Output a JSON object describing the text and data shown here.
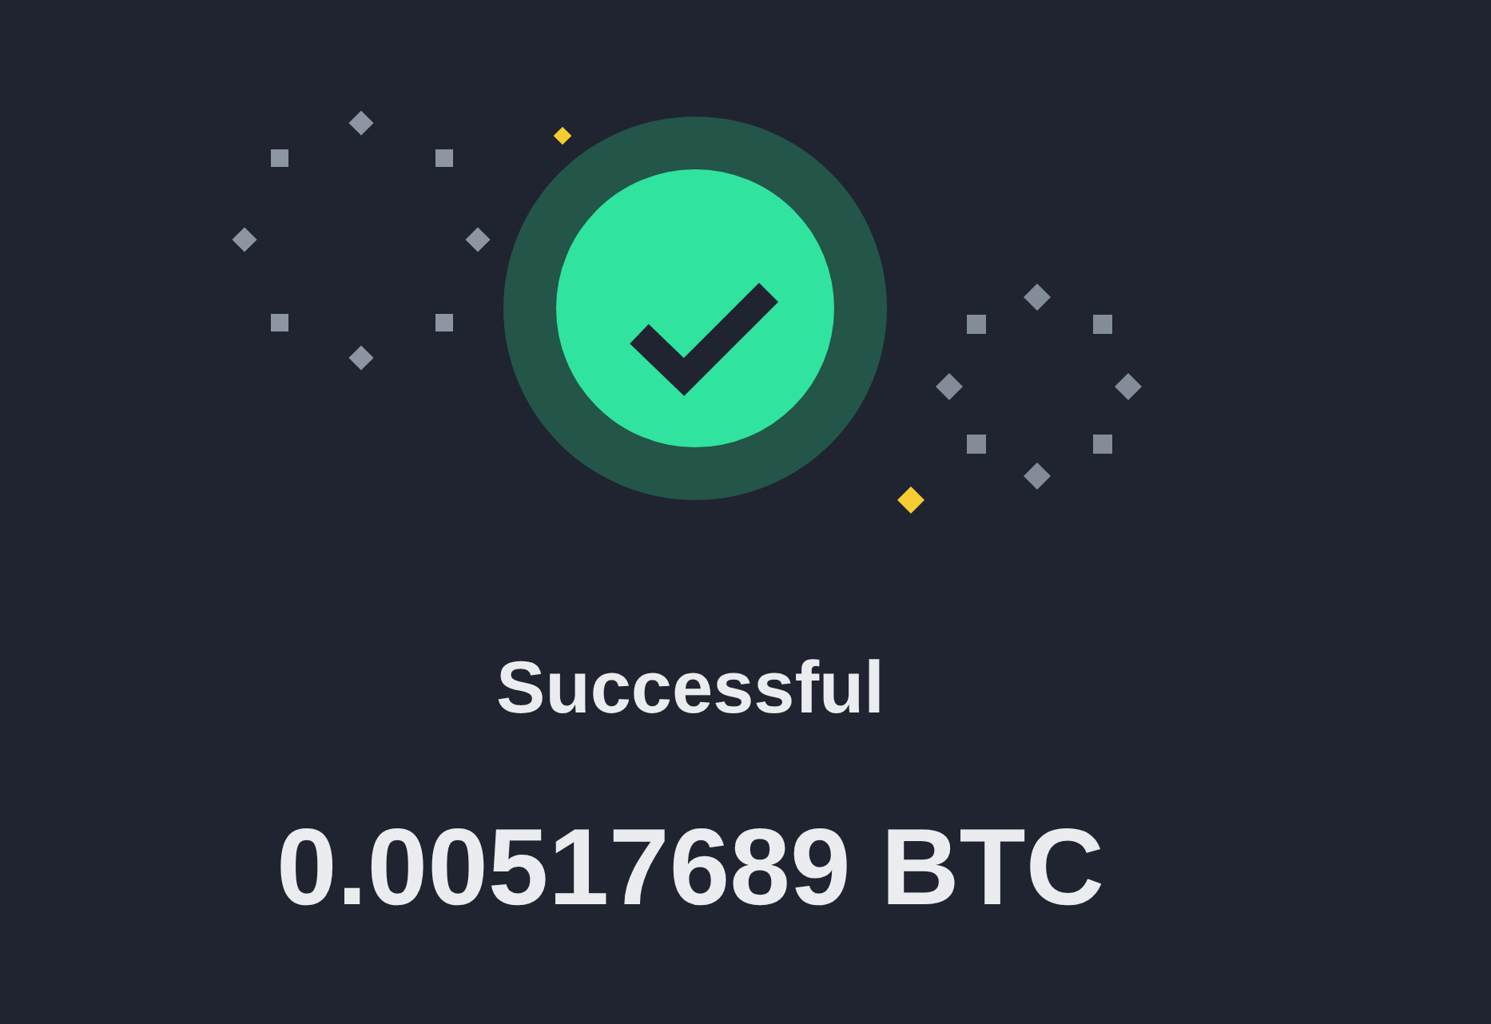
{
  "result": {
    "kind": "success",
    "title": "Successful",
    "amount": "0.00517689 BTC"
  }
}
